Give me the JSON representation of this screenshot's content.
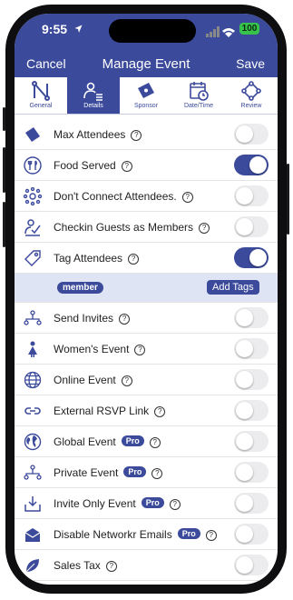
{
  "status_bar": {
    "time": "9:55",
    "battery": "100"
  },
  "header": {
    "cancel_label": "Cancel",
    "title": "Manage Event",
    "save_label": "Save"
  },
  "tabs": [
    {
      "label": "General",
      "icon": "network-n-icon",
      "active": false
    },
    {
      "label": "Details",
      "icon": "people-list-icon",
      "active": true
    },
    {
      "label": "Sponsor",
      "icon": "ticket-star-icon",
      "active": false
    },
    {
      "label": "Date/Time",
      "icon": "calendar-clock-icon",
      "active": false
    },
    {
      "label": "Review",
      "icon": "review-diamond-icon",
      "active": false
    }
  ],
  "settings": [
    {
      "label": "Max Attendees",
      "icon": "ticket-icon",
      "on": false
    },
    {
      "label": "Food Served",
      "icon": "fork-knife-icon",
      "on": true
    },
    {
      "label": "Don't Connect Attendees.",
      "icon": "disconnect-icon",
      "on": false
    },
    {
      "label": "Checkin Guests as Members",
      "icon": "checkin-icon",
      "on": false
    },
    {
      "label": "Tag Attendees",
      "icon": "tag-icon",
      "on": true
    },
    {
      "label": "Send Invites",
      "icon": "invite-network-icon",
      "on": false
    },
    {
      "label": "Women's Event",
      "icon": "woman-icon",
      "on": false
    },
    {
      "label": "Online Event",
      "icon": "globe-grid-icon",
      "on": false
    },
    {
      "label": "External RSVP Link",
      "icon": "link-icon",
      "on": false
    },
    {
      "label": "Global Event",
      "icon": "earth-icon",
      "on": false,
      "pro": "Pro"
    },
    {
      "label": "Private Event",
      "icon": "private-network-icon",
      "on": false,
      "pro": "Pro"
    },
    {
      "label": "Invite Only Event",
      "icon": "download-box-icon",
      "on": false,
      "pro": "Pro"
    },
    {
      "label": "Disable Networkr Emails",
      "icon": "envelope-icon",
      "on": false,
      "pro": "Pro"
    },
    {
      "label": "Sales Tax",
      "icon": "leaf-icon",
      "on": false
    }
  ],
  "tags": {
    "chip": "member",
    "add_label": "Add Tags"
  },
  "colors": {
    "accent": "#3b4a9b",
    "tag_band": "#dfe4f4",
    "toggle_off": "#ececef"
  }
}
